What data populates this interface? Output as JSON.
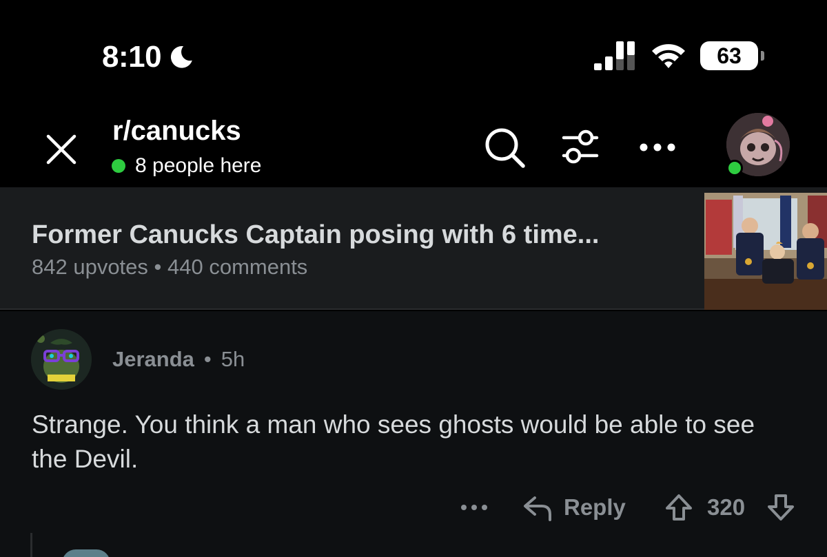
{
  "status_bar": {
    "time": "8:10",
    "battery": "63"
  },
  "header": {
    "subreddit": "r/canucks",
    "online_text": "8 people here"
  },
  "post": {
    "title": "Former Canucks Captain posing with 6 time...",
    "meta": "842 upvotes • 440 comments"
  },
  "comment": {
    "author": "Jeranda",
    "separator": "•",
    "time": "5h",
    "body": "Strange. You think a man who sees ghosts would be able to see the Devil.",
    "more": "•••",
    "reply_label": "Reply",
    "score": "320"
  },
  "colors": {
    "online_green": "#2ecc40",
    "banner_bg": "#1a1c1e",
    "muted_text": "#8a8f94",
    "body_text": "#d7dadc"
  }
}
